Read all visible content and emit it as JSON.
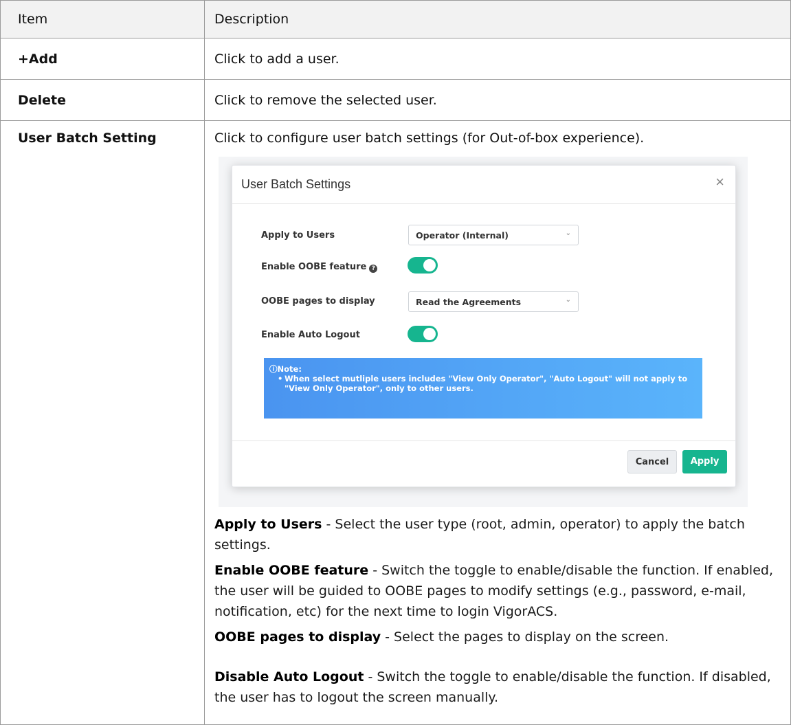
{
  "header": {
    "item": "Item",
    "description": "Description"
  },
  "rows": [
    {
      "item": "+Add",
      "description": "Click to add a user."
    },
    {
      "item": "Delete",
      "description": "Click to remove the selected user."
    },
    {
      "item": "User Batch Setting",
      "description": "Click to configure user batch settings (for Out-of-box experience)."
    }
  ],
  "dialog": {
    "title": "User Batch Settings",
    "close_glyph": "×",
    "fields": {
      "apply_to_users": {
        "label": "Apply to Users",
        "value": "Operator (Internal)"
      },
      "enable_oobe": {
        "label": "Enable OOBE feature",
        "enabled": true
      },
      "oobe_pages": {
        "label": "OOBE pages to display",
        "value": "Read the Agreements"
      },
      "auto_logout": {
        "label": "Enable Auto Logout",
        "enabled": true
      }
    },
    "note": {
      "title": "ⓘNote:",
      "text": "When select mutliple users includes \"View Only Operator\", \"Auto Logout\" will not apply to \"View Only Operator\", only to other users."
    },
    "cancel_label": "Cancel",
    "apply_label": "Apply"
  },
  "explanations": [
    {
      "term": "Apply to Users",
      "text": " - Select the user type (root, admin, operator) to apply the batch settings."
    },
    {
      "term": "Enable OOBE feature",
      "text": " - Switch the toggle to enable/disable the function. If enabled, the user will be guided to OOBE pages to modify settings (e.g., password, e-mail, notification, etc) for the next time to login VigorACS."
    },
    {
      "term": "OOBE pages to display",
      "text": " - Select the pages to display on the screen."
    },
    {
      "term": "Disable Auto Logout",
      "text": " - Switch the toggle to enable/disable the function. If disabled, the user has to logout the screen manually."
    }
  ],
  "colors": {
    "toggle_on": "#16b58f",
    "note_bg": "#4a94f0",
    "apply_btn": "#16b58f"
  },
  "icons": {
    "help": "question-circle-icon",
    "close": "close-icon",
    "chevron": "chevron-down-icon",
    "info": "info-icon"
  }
}
